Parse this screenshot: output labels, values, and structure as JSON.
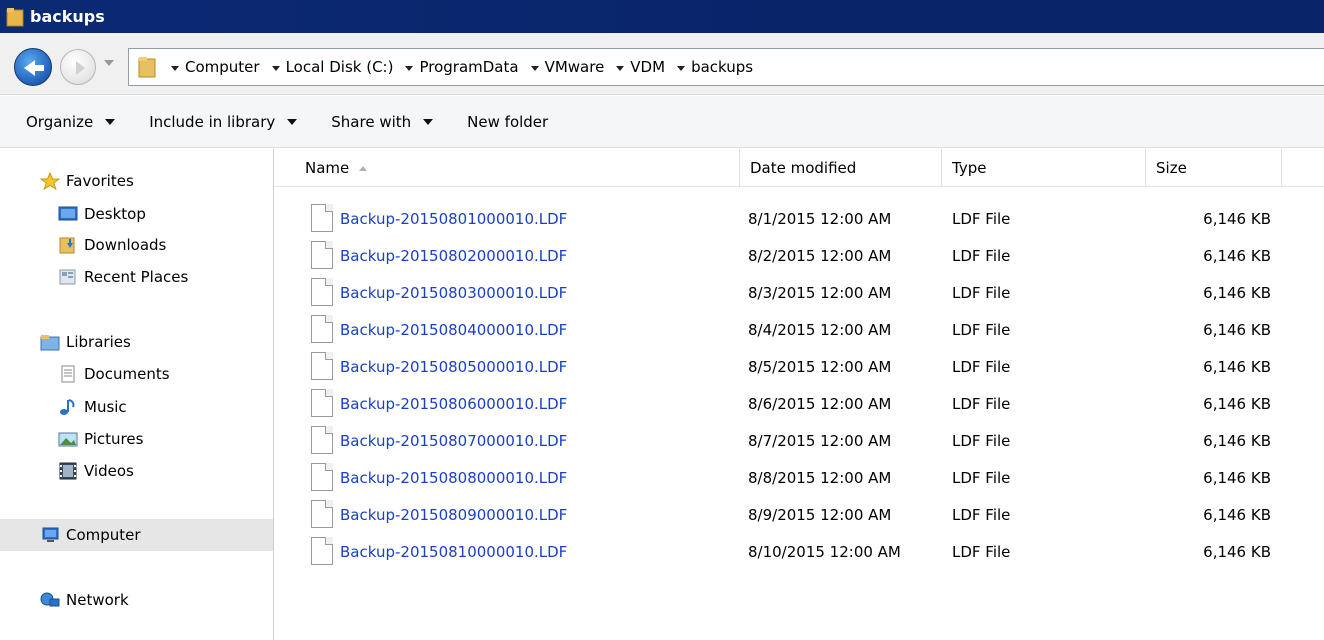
{
  "window": {
    "title": "backups"
  },
  "address": {
    "crumbs": [
      "Computer",
      "Local Disk (C:)",
      "ProgramData",
      "VMware",
      "VDM",
      "backups"
    ]
  },
  "toolbar": {
    "organize": "Organize",
    "include_in_library": "Include in library",
    "share_with": "Share with",
    "new_folder": "New folder"
  },
  "nav": {
    "favorites": "Favorites",
    "desktop": "Desktop",
    "downloads": "Downloads",
    "recent_places": "Recent Places",
    "libraries": "Libraries",
    "documents": "Documents",
    "music": "Music",
    "pictures": "Pictures",
    "videos": "Videos",
    "computer": "Computer",
    "network": "Network"
  },
  "columns": {
    "name": "Name",
    "date_modified": "Date modified",
    "type": "Type",
    "size": "Size"
  },
  "files": [
    {
      "name": "Backup-20150801000010.LDF",
      "date": "8/1/2015 12:00 AM",
      "type": "LDF File",
      "size": "6,146 KB"
    },
    {
      "name": "Backup-20150802000010.LDF",
      "date": "8/2/2015 12:00 AM",
      "type": "LDF File",
      "size": "6,146 KB"
    },
    {
      "name": "Backup-20150803000010.LDF",
      "date": "8/3/2015 12:00 AM",
      "type": "LDF File",
      "size": "6,146 KB"
    },
    {
      "name": "Backup-20150804000010.LDF",
      "date": "8/4/2015 12:00 AM",
      "type": "LDF File",
      "size": "6,146 KB"
    },
    {
      "name": "Backup-20150805000010.LDF",
      "date": "8/5/2015 12:00 AM",
      "type": "LDF File",
      "size": "6,146 KB"
    },
    {
      "name": "Backup-20150806000010.LDF",
      "date": "8/6/2015 12:00 AM",
      "type": "LDF File",
      "size": "6,146 KB"
    },
    {
      "name": "Backup-20150807000010.LDF",
      "date": "8/7/2015 12:00 AM",
      "type": "LDF File",
      "size": "6,146 KB"
    },
    {
      "name": "Backup-20150808000010.LDF",
      "date": "8/8/2015 12:00 AM",
      "type": "LDF File",
      "size": "6,146 KB"
    },
    {
      "name": "Backup-20150809000010.LDF",
      "date": "8/9/2015 12:00 AM",
      "type": "LDF File",
      "size": "6,146 KB"
    },
    {
      "name": "Backup-20150810000010.LDF",
      "date": "8/10/2015 12:00 AM",
      "type": "LDF File",
      "size": "6,146 KB"
    }
  ],
  "colors": {
    "title_bar": "#0a246a",
    "file_link": "#1a3fc7",
    "selected_nav": "#e6e6e6"
  }
}
